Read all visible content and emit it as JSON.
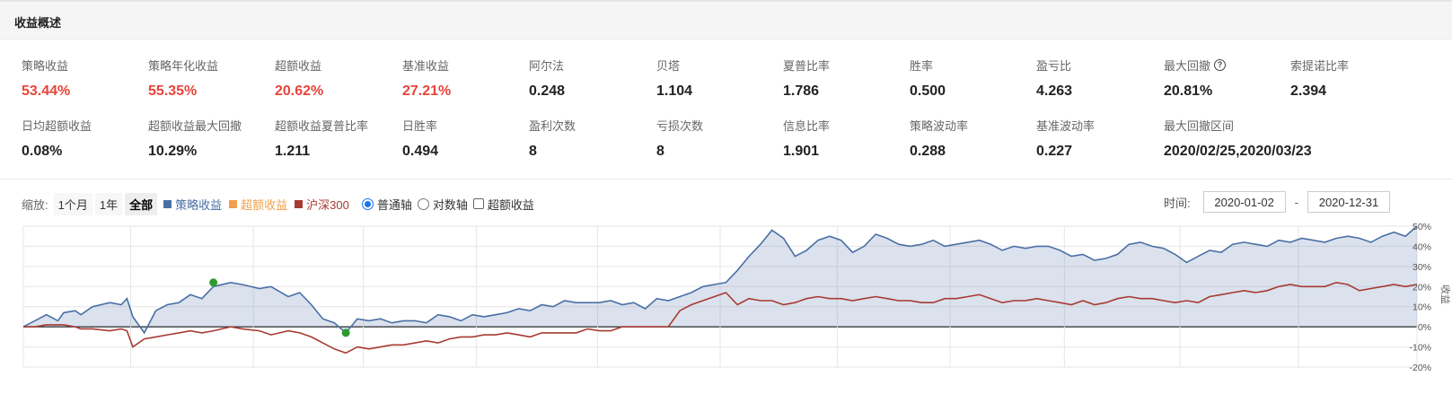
{
  "header": {
    "title": "收益概述"
  },
  "metrics_row1": [
    {
      "label": "策略收益",
      "value": "53.44%",
      "color": "red"
    },
    {
      "label": "策略年化收益",
      "value": "55.35%",
      "color": "red"
    },
    {
      "label": "超额收益",
      "value": "20.62%",
      "color": "red"
    },
    {
      "label": "基准收益",
      "value": "27.21%",
      "color": "red"
    },
    {
      "label": "阿尔法",
      "value": "0.248",
      "color": "black"
    },
    {
      "label": "贝塔",
      "value": "1.104",
      "color": "black"
    },
    {
      "label": "夏普比率",
      "value": "1.786",
      "color": "black"
    },
    {
      "label": "胜率",
      "value": "0.500",
      "color": "black"
    },
    {
      "label": "盈亏比",
      "value": "4.263",
      "color": "black"
    },
    {
      "label": "最大回撤",
      "value": "20.81%",
      "color": "black",
      "help": "?"
    },
    {
      "label": "索提诺比率",
      "value": "2.394",
      "color": "black"
    }
  ],
  "metrics_row2": [
    {
      "label": "日均超额收益",
      "value": "0.08%"
    },
    {
      "label": "超额收益最大回撤",
      "value": "10.29%"
    },
    {
      "label": "超额收益夏普比率",
      "value": "1.211"
    },
    {
      "label": "日胜率",
      "value": "0.494"
    },
    {
      "label": "盈利次数",
      "value": "8"
    },
    {
      "label": "亏损次数",
      "value": "8"
    },
    {
      "label": "信息比率",
      "value": "1.901"
    },
    {
      "label": "策略波动率",
      "value": "0.288"
    },
    {
      "label": "基准波动率",
      "value": "0.227"
    },
    {
      "label": "最大回撤区间",
      "value": "2020/02/25,2020/03/23"
    }
  ],
  "toolbar": {
    "zoom_label": "缩放:",
    "zoom_buttons": [
      "1个月",
      "1年",
      "全部"
    ],
    "zoom_active": "全部",
    "legend": [
      {
        "label": "策略收益",
        "color": "#4a6fa5"
      },
      {
        "label": "超额收益",
        "color": "#f0a04b"
      },
      {
        "label": "沪深300",
        "color": "#a83a32"
      }
    ],
    "axis_options": [
      {
        "label": "普通轴",
        "checked": true
      },
      {
        "label": "对数轴",
        "checked": false
      }
    ],
    "excess_checkbox": {
      "label": "超额收益",
      "checked": false
    }
  },
  "time_range": {
    "label": "时间:",
    "start": "2020-01-02",
    "end": "2020-12-31",
    "separator": "-"
  },
  "chart_data": {
    "type": "area",
    "ylabel": "收益",
    "yticks": [
      "50%",
      "40%",
      "30%",
      "20%",
      "10%",
      "0%",
      "-10%",
      "-20%"
    ],
    "ylim": [
      -20,
      50
    ],
    "x": [
      0,
      2,
      4,
      6,
      7,
      9,
      10,
      12,
      15,
      17,
      18,
      19,
      21,
      23,
      25,
      27,
      29,
      31,
      33,
      36,
      38,
      41,
      43,
      46,
      48,
      50,
      52,
      54,
      56,
      58,
      60,
      62,
      64,
      66,
      68,
      70,
      72,
      74,
      76,
      78,
      80,
      82,
      84,
      86,
      88,
      90,
      92,
      94,
      96,
      98,
      100,
      102,
      104,
      106,
      108,
      110,
      112,
      114,
      116,
      118,
      120,
      122,
      124,
      126,
      128,
      130,
      132,
      134,
      136,
      138,
      140,
      142,
      144,
      146,
      148,
      150,
      152,
      154,
      156,
      158,
      160,
      162,
      164,
      166,
      168,
      170,
      172,
      174,
      176,
      178,
      180,
      182,
      184,
      186,
      188,
      190,
      192,
      194,
      196,
      198,
      200,
      202,
      204,
      206,
      208,
      210,
      212,
      214,
      216,
      218,
      220,
      222,
      224,
      226,
      228,
      230,
      232,
      234,
      236,
      238,
      240,
      242
    ],
    "series": [
      {
        "name": "策略收益",
        "color": "#4a6fa5",
        "values": [
          0,
          3,
          6,
          3,
          7,
          8,
          6,
          10,
          12,
          11,
          14,
          5,
          -3,
          8,
          11,
          12,
          16,
          14,
          20,
          22,
          21,
          19,
          20,
          15,
          17,
          11,
          4,
          2,
          -3,
          4,
          3,
          4,
          2,
          3,
          3,
          2,
          6,
          5,
          3,
          6,
          5,
          6,
          7,
          9,
          8,
          11,
          10,
          13,
          12,
          12,
          12,
          13,
          11,
          12,
          9,
          14,
          13,
          15,
          17,
          20,
          21,
          22,
          28,
          35,
          41,
          48,
          44,
          35,
          38,
          43,
          45,
          43,
          37,
          40,
          46,
          44,
          41,
          40,
          41,
          43,
          40,
          41,
          42,
          43,
          41,
          38,
          40,
          39,
          40,
          40,
          38,
          35,
          36,
          33,
          34,
          36,
          41,
          42,
          40,
          39,
          36,
          32,
          35,
          38,
          37,
          41,
          42,
          41,
          40,
          43,
          42,
          44,
          43,
          42,
          44,
          45,
          44,
          42,
          45,
          47,
          45,
          50
        ]
      },
      {
        "name": "沪深300",
        "color": "#a83a32",
        "values": [
          0,
          0,
          1,
          1,
          1,
          0,
          -1,
          -1,
          -2,
          -1,
          -2,
          -10,
          -6,
          -5,
          -4,
          -3,
          -2,
          -3,
          -2,
          0,
          -1,
          -2,
          -4,
          -2,
          -3,
          -5,
          -8,
          -11,
          -13,
          -10,
          -11,
          -10,
          -9,
          -9,
          -8,
          -7,
          -8,
          -6,
          -5,
          -5,
          -4,
          -4,
          -3,
          -4,
          -5,
          -3,
          -3,
          -3,
          -3,
          -1,
          -2,
          -2,
          0,
          0,
          0,
          0,
          0,
          8,
          11,
          13,
          15,
          17,
          11,
          14,
          13,
          13,
          11,
          12,
          14,
          15,
          14,
          14,
          13,
          14,
          15,
          14,
          13,
          13,
          12,
          12,
          14,
          14,
          15,
          16,
          14,
          12,
          13,
          13,
          14,
          13,
          12,
          11,
          13,
          11,
          12,
          14,
          15,
          14,
          14,
          13,
          12,
          13,
          12,
          15,
          16,
          17,
          18,
          17,
          18,
          20,
          21,
          20,
          20,
          20,
          22,
          21,
          18,
          19,
          20,
          21,
          20,
          21
        ]
      }
    ],
    "markers": [
      {
        "series": "策略收益",
        "x": 33,
        "value": 22,
        "color": "#2e9b2e"
      },
      {
        "series": "策略收益",
        "x": 56,
        "value": -3,
        "color": "#2e9b2e"
      }
    ]
  }
}
